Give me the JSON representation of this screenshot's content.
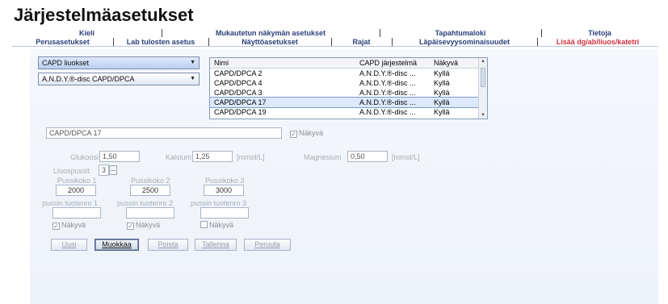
{
  "window": {
    "title": "Järjestelmäasetukset"
  },
  "tabs": {
    "row1": [
      "Kieli",
      "Mukautetun näkymän asetukset",
      "Tapahtumaloki",
      "Tietoja"
    ],
    "row2": [
      "Perusasetukset",
      "Lab tulosten asetus",
      "Näyttöasetukset",
      "Rajat",
      "Läpäisevyysominaisuudet",
      "Lisää dg/ab/liuos/katetri"
    ]
  },
  "left": {
    "category_combo": "CAPD liuokset",
    "system_combo": "A.N.D.Y.®-disc CAPD/DPCA"
  },
  "list": {
    "headers": [
      "Nimi",
      "CAPD järjestelmä",
      "Näkyvä"
    ],
    "rows": [
      [
        "CAPD/DPCA 2",
        "A.N.D.Y.®-disc ...",
        "Kyllä"
      ],
      [
        "CAPD/DPCA 4",
        "A.N.D.Y.®-disc ...",
        "Kyllä"
      ],
      [
        "CAPD/DPCA 3",
        "A.N.D.Y.®-disc ...",
        "Kyllä"
      ],
      [
        "CAPD/DPCA 17",
        "A.N.D.Y.®-disc ...",
        "Kyllä"
      ],
      [
        "CAPD/DPCA 19",
        "A.N.D.Y.®-disc ...",
        "Kyllä"
      ]
    ]
  },
  "form": {
    "name_value": "CAPD/DPCA 17",
    "visible_label": "Näkyvä",
    "glucose_label": "Glukoosi",
    "glucose_value": "1,50",
    "calcium_label": "Kalsium",
    "calcium_value": "1,25",
    "calcium_unit": "[mmol/L]",
    "magnesium_label": "Magnesium",
    "magnesium_value": "0,50",
    "magnesium_unit": "[mmol/L]",
    "solutions_label": "Liuospussit",
    "solutions_value": "3",
    "bag_labels": [
      "Pussikoko 1",
      "Pussikoko 2",
      "Pussikoko 3"
    ],
    "bag_values": [
      "2000",
      "2500",
      "3000"
    ],
    "product_labels": [
      "pussin tuotenro 1",
      "pussin tuotenro 2",
      "pussin tuotenro 3"
    ],
    "product_values": [
      "",
      "",
      ""
    ],
    "visible_checks": [
      "Näkyvä",
      "Näkyvä",
      "Näkyvä"
    ]
  },
  "buttons": {
    "new": "Uusi",
    "edit": "Muokkaa",
    "delete": "Poista",
    "save": "Tallenna",
    "cancel": "Peruuta"
  }
}
